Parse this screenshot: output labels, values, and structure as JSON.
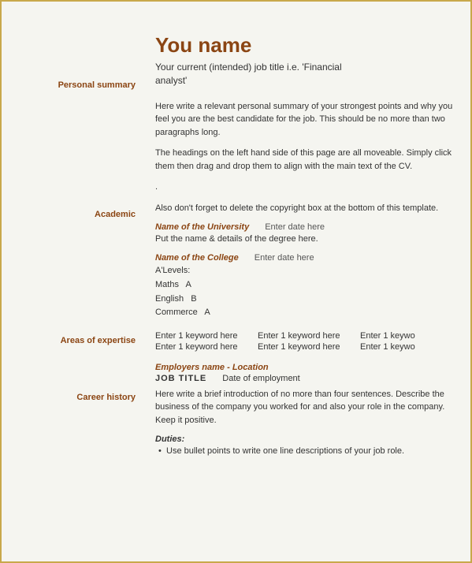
{
  "page": {
    "border_color": "#c8a84b"
  },
  "sidebar": {
    "personal_summary_label": "Personal summary",
    "academic_label": "Academic",
    "areas_label": "Areas of expertise",
    "career_label": "Career history"
  },
  "main": {
    "name": "You name",
    "job_title_line1": "Your current (intended) job title i.e. 'Financial",
    "job_title_line2": "analyst'",
    "personal_summary_para1": "Here write a relevant personal summary of your strongest points and why you feel you are the best candidate for the job. This should be no more than two paragraphs long.",
    "personal_summary_para2": "The headings on the left hand side of this page are all moveable. Simply click them then drag and drop them to align with the main text of the CV.",
    "personal_summary_para3": ".",
    "personal_summary_para4": "Also don't forget to delete the copyright box at the bottom of this template.",
    "academic": {
      "university_name": "Name of the University",
      "university_date": "Enter date here",
      "university_detail": "Put the name & details of the degree here.",
      "college_name": "Name of the College",
      "college_date": "Enter date here",
      "alevels_label": "A'Levels:",
      "subjects": [
        {
          "name": "Maths",
          "grade": "A"
        },
        {
          "name": "English",
          "grade": "B"
        },
        {
          "name": "Commerce",
          "grade": "A"
        }
      ]
    },
    "areas_keywords": [
      [
        "Enter 1 keyword here",
        "Enter 1 keyword here",
        "Enter 1 keywo"
      ],
      [
        "Enter 1 keyword here",
        "Enter 1 keyword here",
        "Enter 1 keywo"
      ]
    ],
    "career": {
      "employer_name": "Employers name - Location",
      "job_title": "JOB TITLE",
      "date_of_employment": "Date of employment",
      "intro_text": "Here write a brief introduction of no more than four sentences. Describe the business of the company you worked for and also your role in the company. Keep it positive.",
      "duties_label": "Duties:",
      "bullet": "Use bullet points to write one line descriptions of your job role."
    }
  }
}
